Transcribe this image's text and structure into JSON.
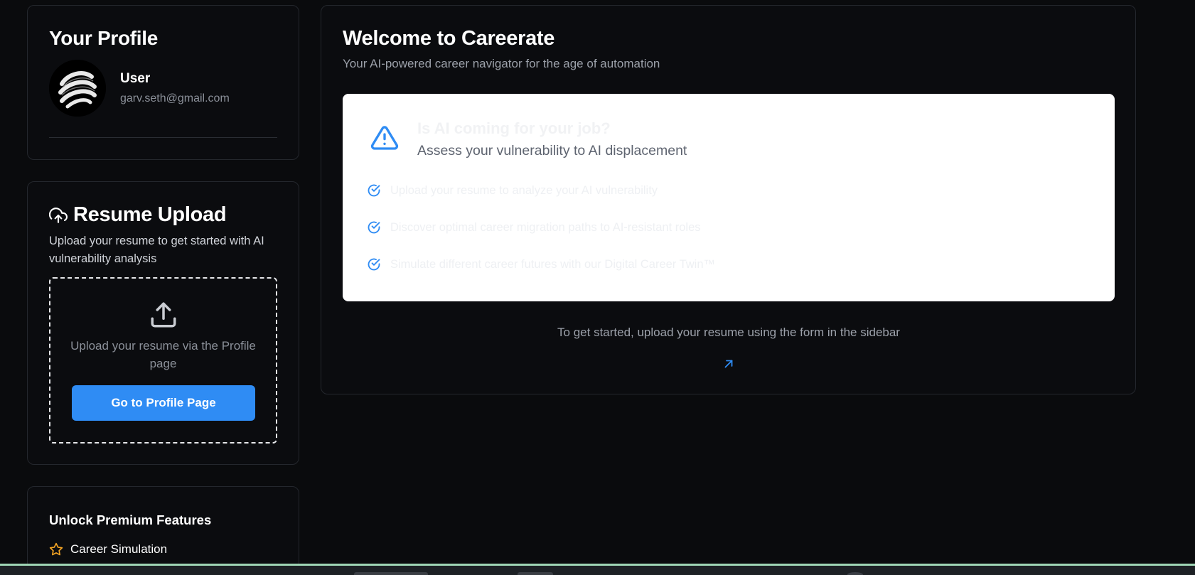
{
  "profile": {
    "title": "Your Profile",
    "user_name": "User",
    "email": "garv.seth@gmail.com"
  },
  "resume": {
    "title": "Resume Upload",
    "description": "Upload your resume to get started with AI vulnerability analysis",
    "dropzone_text": "Upload your resume via the Profile page",
    "button_label": "Go to Profile Page"
  },
  "premium": {
    "title": "Unlock Premium Features",
    "items": [
      {
        "label": "Career Simulation",
        "icon": "star-icon"
      }
    ]
  },
  "main": {
    "title": "Welcome to Careerate",
    "subtitle": "Your AI-powered career navigator for the age of automation",
    "panel": {
      "heading": "Is AI coming for your job?",
      "subheading": "Assess your vulnerability to AI displacement",
      "features": [
        "Upload your resume to analyze your AI vulnerability",
        "Discover optimal career migration paths to AI-resistant roles",
        "Simulate different career futures with our Digital Career Twin™"
      ]
    },
    "hint": "To get started, upload your resume using the form in the sidebar"
  },
  "colors": {
    "accent": "#2f8cf4",
    "background": "#0a0b0d",
    "card_border": "#24272d",
    "star": "#f5a524"
  }
}
